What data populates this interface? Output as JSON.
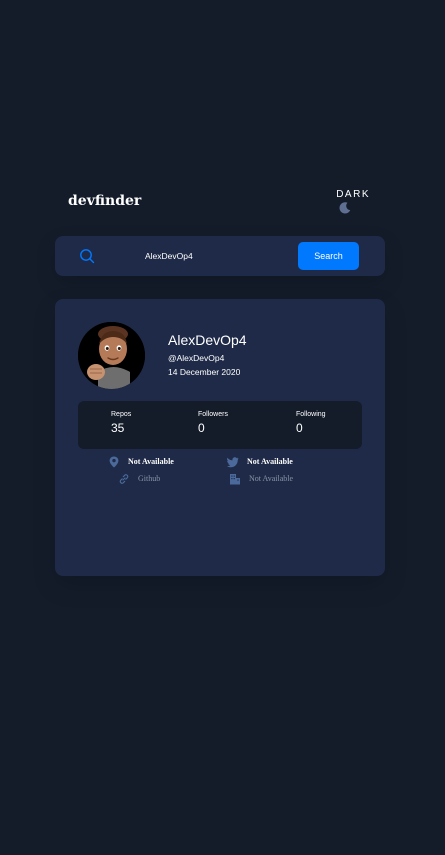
{
  "header": {
    "logo": "devfinder",
    "theme_label": "DARK"
  },
  "search": {
    "value": "AlexDevOp4",
    "button_label": "Search"
  },
  "profile": {
    "name": "AlexDevOp4",
    "login": "@AlexDevOp4",
    "joined": "14 December 2020"
  },
  "stats": {
    "repos": {
      "label": "Repos",
      "value": "35"
    },
    "followers": {
      "label": "Followers",
      "value": "0"
    },
    "following": {
      "label": "Following",
      "value": "0"
    }
  },
  "links": {
    "location": "Not Available",
    "twitter": "Not Available",
    "blog": "Github",
    "company": "Not Available"
  },
  "colors": {
    "background": "#141c2a",
    "card": "#1e2a47",
    "accent": "#0079ff",
    "icon": "#4b6a9b"
  },
  "icons": {
    "theme": "moon-icon",
    "search": "search-icon",
    "location": "location-pin-icon",
    "twitter": "twitter-icon",
    "blog": "link-icon",
    "company": "building-icon"
  }
}
